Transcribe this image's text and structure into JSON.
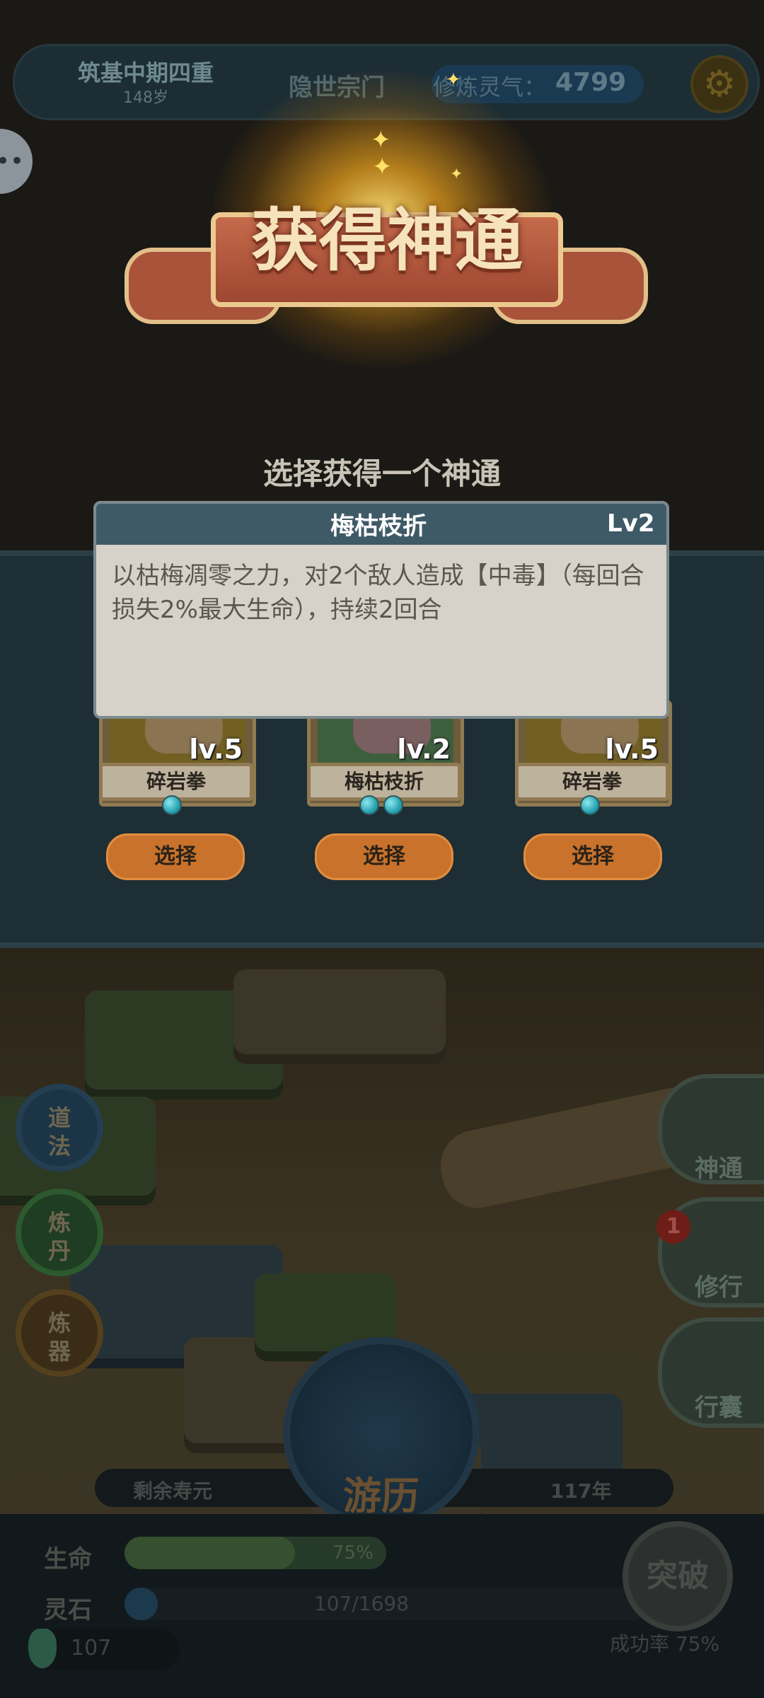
{
  "header": {
    "realm_name": "筑基中期四重",
    "realm_age": "148岁",
    "sect_name": "隐世宗门",
    "spirit_label": "修炼灵气：",
    "spirit_value": "4799",
    "settings_icon": "gear-icon",
    "chat_icon": "chat-bubble-icon"
  },
  "banner": {
    "title": "获得神通",
    "sparkle_glyph": "✦"
  },
  "choose_title": "选择获得一个神通",
  "tooltip": {
    "title": "梅枯枝折",
    "level": "Lv2",
    "description": "以枯梅凋零之力，对2个敌人造成【中毒】（每回合损失2%最大生命），持续2回合"
  },
  "cards": [
    {
      "name": "碎岩拳",
      "level": "lv.5",
      "dots": 1,
      "art_color": "#716022",
      "select_label": "选择"
    },
    {
      "name": "梅枯枝折",
      "level": "lv.2",
      "dots": 2,
      "art_color": "#3e5f3e",
      "select_label": "选择"
    },
    {
      "name": "碎岩拳",
      "level": "lv.5",
      "dots": 1,
      "art_color": "#716022",
      "select_label": "选择"
    }
  ],
  "left_buttons": {
    "dao": "道\n法",
    "dan": "炼\n丹",
    "qi": "炼\n器"
  },
  "right_buttons": {
    "shentong": "神通",
    "xiuxing": "修行",
    "xingnang": "行囊",
    "badge_count": "1"
  },
  "journey": {
    "label": "游历",
    "lifespan_label": "剩余寿元",
    "lifespan_value": "117年"
  },
  "stats": {
    "hp_label": "生命",
    "hp_fraction": 0.65,
    "hp_text": "75%",
    "stone_label": "灵石",
    "stone_text": "107/1698",
    "stone_fraction": 0.063,
    "gem_value": "107"
  },
  "breakthrough": {
    "label": "突破",
    "rate_text": "成功率 75%"
  },
  "colors": {
    "banner_red": "#c56a4b",
    "banner_gold": "#ecc98f",
    "select_orange": "#c8722b",
    "tooltip_header": "#3f5a67"
  }
}
